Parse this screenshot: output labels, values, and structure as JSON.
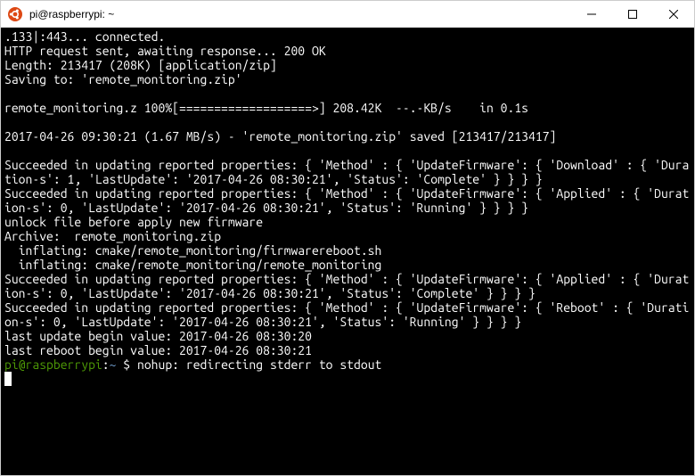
{
  "window": {
    "title": "pi@raspberrypi: ~",
    "icon_name": "ubuntu-logo-icon"
  },
  "terminal": {
    "lines": [
      ".133|:443... connected.",
      "HTTP request sent, awaiting response... 200 OK",
      "Length: 213417 (208K) [application/zip]",
      "Saving to: 'remote_monitoring.zip'",
      "",
      "remote_monitoring.z 100%[===================>] 208.42K  --.-KB/s    in 0.1s",
      "",
      "2017-04-26 09:30:21 (1.67 MB/s) - 'remote_monitoring.zip' saved [213417/213417]",
      "",
      "Succeeded in updating reported properties: { 'Method' : { 'UpdateFirmware': { 'Download' : { 'Duration-s': 1, 'LastUpdate': '2017-04-26 08:30:21', 'Status': 'Complete' } } } }",
      "Succeeded in updating reported properties: { 'Method' : { 'UpdateFirmware': { 'Applied' : { 'Duration-s': 0, 'LastUpdate': '2017-04-26 08:30:21', 'Status': 'Running' } } } }",
      "unlock file before apply new firmware",
      "Archive:  remote_monitoring.zip",
      "  inflating: cmake/remote_monitoring/firmwarereboot.sh",
      "  inflating: cmake/remote_monitoring/remote_monitoring",
      "Succeeded in updating reported properties: { 'Method' : { 'UpdateFirmware': { 'Applied' : { 'Duration-s': 0, 'LastUpdate': '2017-04-26 08:30:21', 'Status': 'Complete' } } } }",
      "Succeeded in updating reported properties: { 'Method' : { 'UpdateFirmware': { 'Reboot' : { 'Duration-s': 0, 'LastUpdate': '2017-04-26 08:30:21', 'Status': 'Running' } } } }",
      "last update begin value: 2017-04-26 08:30:20",
      "last reboot begin value: 2017-04-26 08:30:21"
    ],
    "prompt_user_host": "pi@raspberrypi",
    "prompt_colon": ":",
    "prompt_path": "~",
    "prompt_symbol": " $ ",
    "prompt_after": "nohup: redirecting stderr to stdout"
  }
}
